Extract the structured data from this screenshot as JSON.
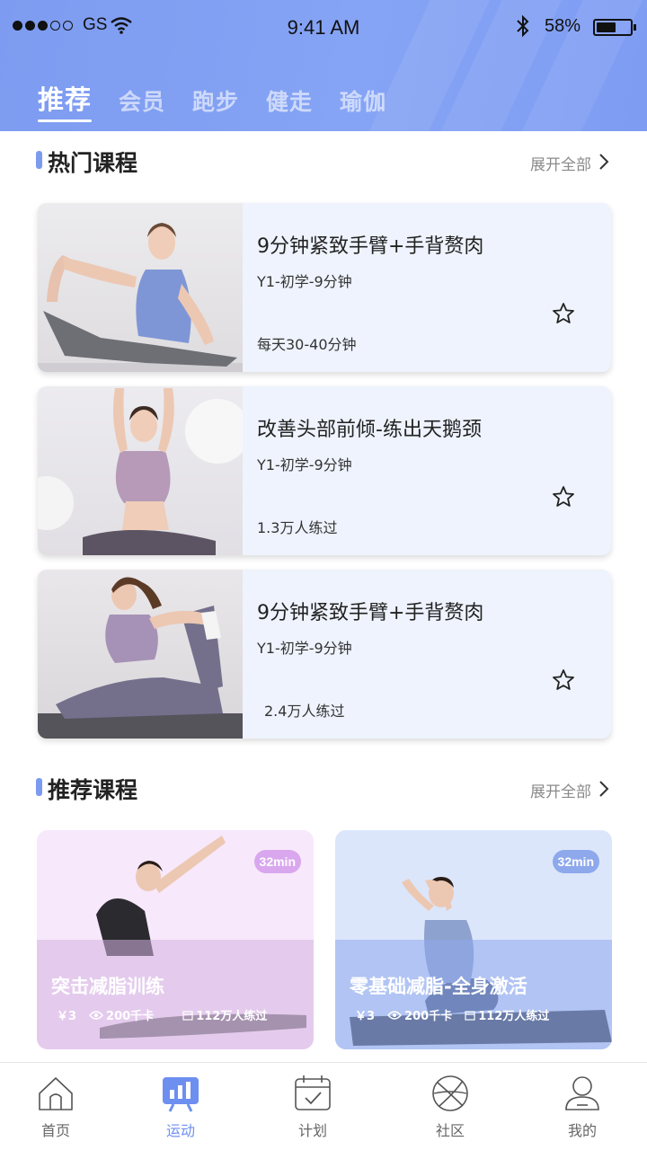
{
  "status_bar": {
    "carrier": "GS",
    "time": "9:41 AM",
    "battery_pct": "58%",
    "battery_level": 0.58
  },
  "tabs": [
    {
      "label": "推荐",
      "active": true
    },
    {
      "label": "会员"
    },
    {
      "label": "跑步"
    },
    {
      "label": "健走"
    },
    {
      "label": "瑜伽"
    }
  ],
  "hot": {
    "title": "热门课程",
    "more": "展开全部",
    "courses": [
      {
        "title": "9分钟紧致手臂+手背赘肉",
        "level": "Y1-初学-9分钟",
        "meta": "每天30-40分钟",
        "icon": "star-icon"
      },
      {
        "title": "改善头部前倾-练出天鹅颈",
        "level": "Y1-初学-9分钟",
        "meta": "1.3万人练过",
        "icon": "star-icon"
      },
      {
        "title": "9分钟紧致手臂+手背赘肉",
        "level": "Y1-初学-9分钟",
        "meta": "2.4万人练过",
        "icon": "star-icon"
      }
    ]
  },
  "recommend": {
    "title": "推荐课程",
    "more": "展开全部",
    "items": [
      {
        "badge": "32min",
        "title": "突击减脂训练",
        "price": "￥3",
        "calories": "200千卡",
        "count": "112万人练过",
        "accent": "#d6b2ee"
      },
      {
        "badge": "32min",
        "title": "零基础减脂-全身激活",
        "price": "￥3",
        "calories": "200千卡",
        "count": "112万人练过",
        "accent": "#8ea8ec"
      }
    ]
  },
  "nav": [
    {
      "label": "首页",
      "icon": "home-icon"
    },
    {
      "label": "运动",
      "icon": "chart-icon",
      "active": true
    },
    {
      "label": "计划",
      "icon": "calendar-icon"
    },
    {
      "label": "社区",
      "icon": "ball-icon"
    },
    {
      "label": "我的",
      "icon": "user-icon"
    }
  ],
  "colors": {
    "accent": "#7b9bf0",
    "header_start": "#7d9bf0",
    "header_end": "#86a4f5"
  }
}
